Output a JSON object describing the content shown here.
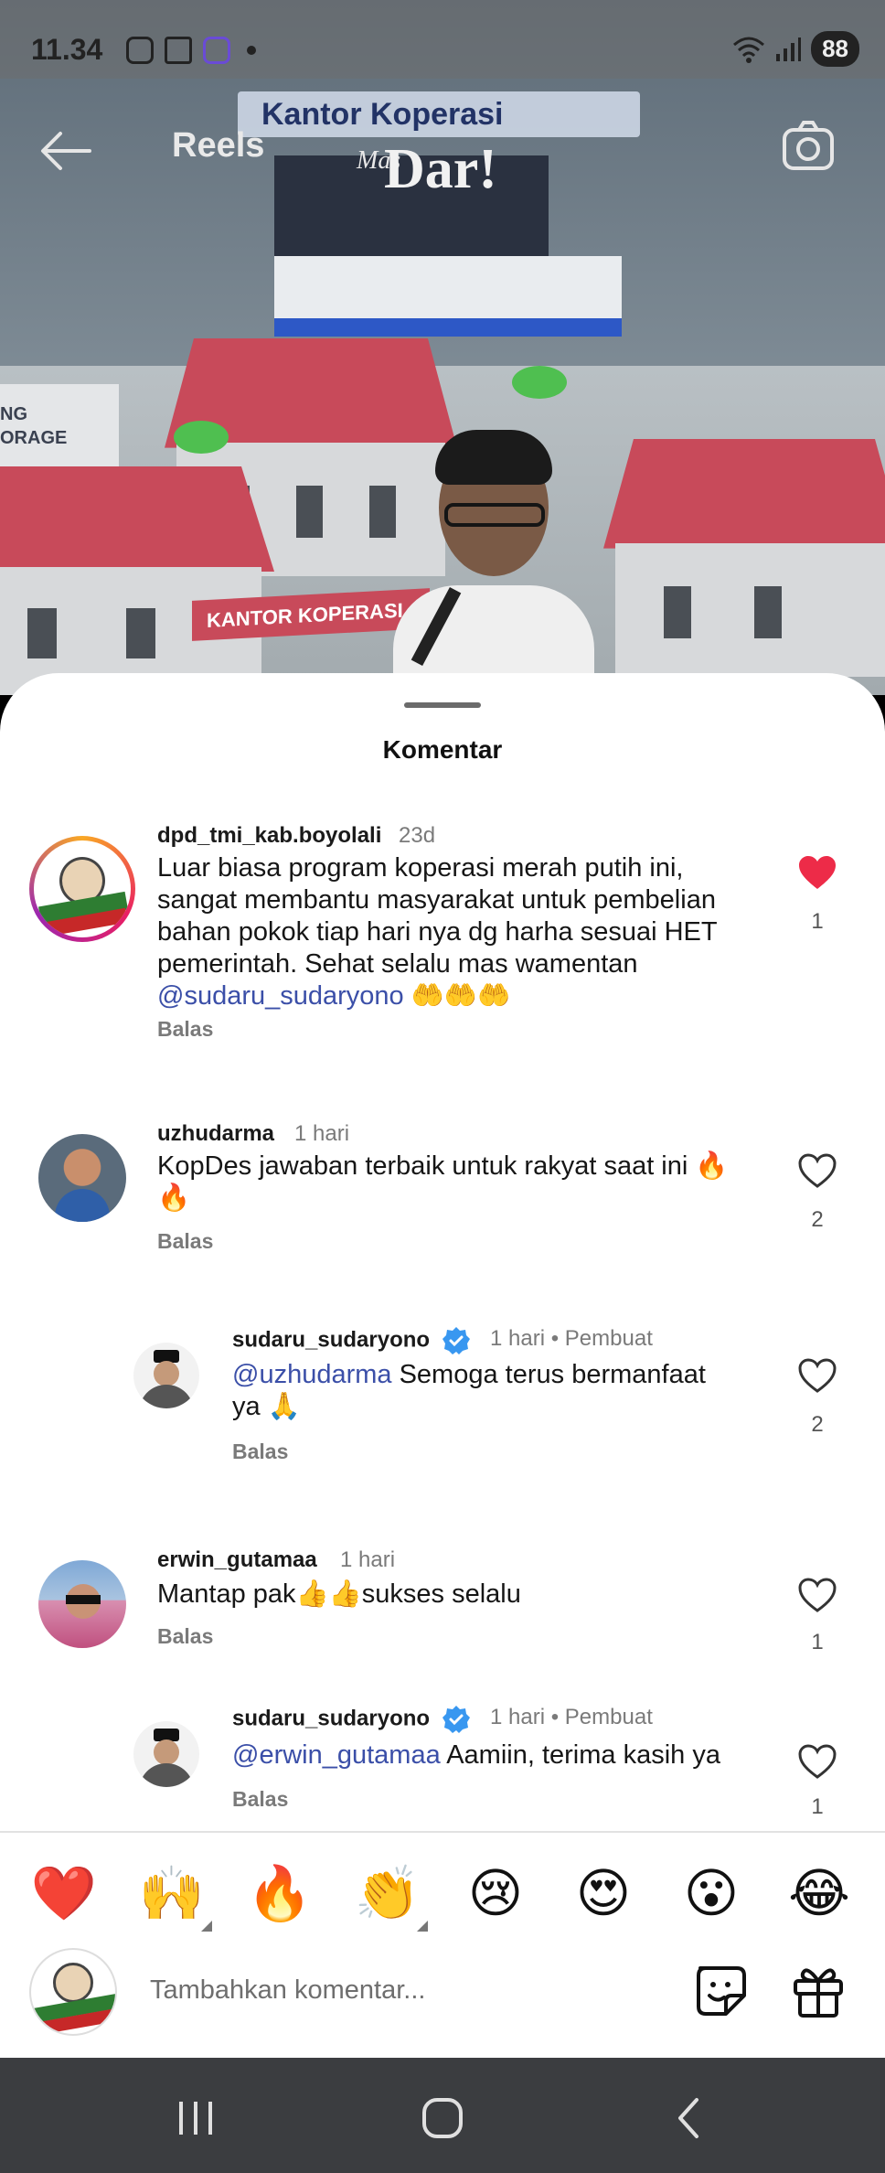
{
  "status_bar": {
    "time": "11.34",
    "battery": "88",
    "icons": [
      "instagram-icon",
      "screenshot-icon",
      "app-cube-icon",
      "dot-icon",
      "wifi-icon",
      "signal-icon"
    ]
  },
  "reels_header": {
    "title": "Reels",
    "back_icon": "arrow-left-icon",
    "camera_icon": "camera-icon"
  },
  "video": {
    "banner_text": "Kantor Koperasi",
    "logo_prefix": "Mas",
    "logo_text": "Dar!",
    "sign_text": "KANTOR KOPERASI",
    "storage_text": "NG\nORAGE"
  },
  "sheet": {
    "title": "Komentar"
  },
  "comments": [
    {
      "username": "dpd_tmi_kab.boyolali",
      "time": "23d",
      "text_lines": [
        "Luar biasa program koperasi merah putih ini,",
        "sangat membantu masyarakat untuk pembelian",
        "bahan pokok tiap hari nya dg harha sesuai HET",
        "pemerintah. Sehat selalu mas wamentan"
      ],
      "mention": "@sudaru_sudaryono",
      "trailing": "🤲🤲🤲",
      "reply_label": "Balas",
      "liked": true,
      "like_count": "1",
      "avatar_text": "TANI MERDEKA INDONESIA"
    },
    {
      "username": "uzhudarma",
      "time": "1 hari",
      "text_lines": [
        "KopDes jawaban terbaik untuk rakyat saat ini 🔥",
        "🔥"
      ],
      "reply_label": "Balas",
      "liked": false,
      "like_count": "2"
    },
    {
      "username": "sudaru_sudaryono",
      "time": "1 hari",
      "creator_label": "Pembuat",
      "mention": "@uzhudarma",
      "text_lines": [
        " Semoga terus bermanfaat",
        "ya 🙏"
      ],
      "reply_label": "Balas",
      "liked": false,
      "like_count": "2"
    },
    {
      "username": "erwin_gutamaa",
      "time": "1 hari",
      "text_lines": [
        "Mantap pak👍👍sukses selalu"
      ],
      "reply_label": "Balas",
      "liked": false,
      "like_count": "1"
    },
    {
      "username": "sudaru_sudaryono",
      "time": "1 hari",
      "creator_label": "Pembuat",
      "mention": "@erwin_gutamaa",
      "text_lines": [
        " Aamiin, terima kasih ya"
      ],
      "reply_label": "Balas",
      "liked": false,
      "like_count": "1"
    }
  ],
  "emoji_bar": [
    "❤️",
    "🙌",
    "🔥",
    "👏",
    "😢",
    "😍",
    "😮",
    "😂"
  ],
  "composer": {
    "placeholder": "Tambahkan komentar...",
    "sticker_icon": "sticker-icon",
    "gift_icon": "gift-icon"
  },
  "navbar": {
    "icons": [
      "recent-apps-icon",
      "home-icon",
      "back-icon"
    ]
  },
  "colors": {
    "mention": "#3b4fa8",
    "heart_liked": "#ed2b48",
    "verified": "#3897f0",
    "navbar": "#3b3d40"
  }
}
